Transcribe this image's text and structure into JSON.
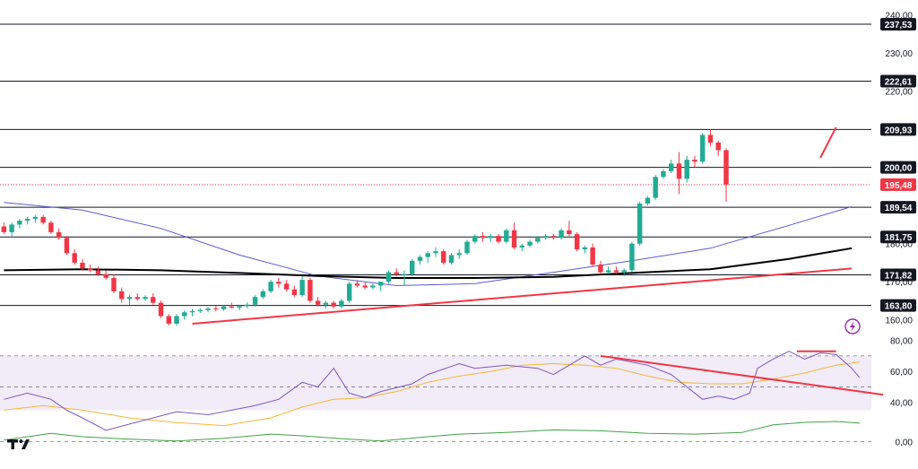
{
  "colors": {
    "up": "#22ab94",
    "down": "#f23645",
    "level_line": "#131722",
    "trend_line": "#f23645",
    "ma_fast": "#5b5bd6",
    "ma_slow": "#000000",
    "rsi_line": "#7e57c2",
    "rsi_ma": "#f7b733",
    "rsi_band": "#ede7f6",
    "macd_line": "#43a047",
    "current_price": "#f23645",
    "axis_text": "#131722"
  },
  "icons": {
    "logo": "tradingview-logo-icon",
    "alert": "lightning-icon"
  },
  "logo_text": "TV",
  "chart_data": [
    {
      "type": "candlestick",
      "title": "",
      "ylim": [
        155,
        242
      ],
      "price_axis_ticks": [
        "240,00",
        "230,00",
        "220,00",
        "180,00",
        "170,00",
        "160,00"
      ],
      "price_axis_tick_values": [
        240,
        230,
        220,
        180,
        170,
        160
      ],
      "levels": [
        {
          "value": 237.53,
          "label": "237,53"
        },
        {
          "value": 222.61,
          "label": "222,61"
        },
        {
          "value": 209.93,
          "label": "209,93"
        },
        {
          "value": 200.0,
          "label": "200,00"
        },
        {
          "value": 189.54,
          "label": "189,54"
        },
        {
          "value": 181.75,
          "label": "181,75"
        },
        {
          "value": 171.82,
          "label": "171,82"
        },
        {
          "value": 163.8,
          "label": "163,80"
        }
      ],
      "current_price": {
        "value": 195.48,
        "label": "195,48"
      },
      "candles": [
        [
          184.5,
          185.5,
          182.5,
          183.0
        ],
        [
          183.0,
          185.5,
          182.0,
          185.0
        ],
        [
          185.0,
          186.5,
          184.0,
          186.0
        ],
        [
          186.0,
          187.0,
          185.0,
          186.5
        ],
        [
          186.5,
          187.5,
          185.5,
          187.0
        ],
        [
          187.0,
          187.5,
          185.0,
          185.5
        ],
        [
          185.5,
          186.0,
          182.5,
          183.0
        ],
        [
          183.0,
          184.0,
          181.0,
          181.5
        ],
        [
          181.5,
          182.0,
          177.0,
          177.5
        ],
        [
          177.5,
          178.5,
          174.5,
          175.0
        ],
        [
          175.0,
          176.0,
          173.0,
          173.5
        ],
        [
          173.5,
          174.5,
          172.5,
          173.0
        ],
        [
          173.0,
          174.0,
          171.5,
          172.0
        ],
        [
          172.0,
          173.0,
          170.5,
          171.0
        ],
        [
          171.0,
          172.0,
          167.0,
          167.5
        ],
        [
          167.5,
          168.5,
          164.5,
          165.5
        ],
        [
          165.5,
          166.5,
          164.0,
          166.0
        ],
        [
          166.0,
          167.0,
          165.0,
          165.5
        ],
        [
          165.5,
          166.5,
          165.0,
          166.0
        ],
        [
          166.0,
          167.0,
          164.0,
          164.5
        ],
        [
          164.5,
          165.0,
          160.5,
          161.0
        ],
        [
          161.0,
          161.5,
          158.5,
          159.0
        ],
        [
          159.0,
          161.5,
          158.5,
          161.0
        ],
        [
          161.0,
          162.5,
          160.0,
          162.0
        ],
        [
          162.0,
          162.8,
          161.0,
          162.3
        ],
        [
          162.3,
          163.0,
          161.8,
          162.6
        ],
        [
          162.6,
          163.4,
          162.0,
          163.0
        ],
        [
          163.0,
          163.6,
          162.2,
          162.8
        ],
        [
          162.8,
          163.8,
          162.4,
          163.5
        ],
        [
          163.5,
          164.5,
          163.0,
          163.2
        ],
        [
          163.2,
          164.0,
          162.5,
          163.6
        ],
        [
          163.6,
          164.6,
          163.0,
          164.0
        ],
        [
          164.0,
          166.5,
          163.5,
          166.0
        ],
        [
          166.0,
          168.0,
          165.5,
          167.5
        ],
        [
          167.5,
          170.5,
          167.0,
          170.0
        ],
        [
          170.0,
          171.0,
          168.5,
          169.5
        ],
        [
          169.5,
          170.5,
          167.5,
          168.0
        ],
        [
          168.0,
          169.0,
          166.0,
          166.5
        ],
        [
          166.5,
          171.5,
          166.0,
          170.5
        ],
        [
          170.5,
          171.0,
          164.5,
          165.0
        ],
        [
          165.0,
          166.0,
          163.5,
          164.0
        ],
        [
          164.0,
          165.0,
          163.0,
          164.5
        ],
        [
          164.5,
          165.0,
          163.0,
          163.5
        ],
        [
          163.5,
          165.5,
          163.0,
          165.0
        ],
        [
          165.0,
          170.0,
          164.5,
          169.5
        ],
        [
          169.5,
          170.5,
          168.5,
          169.0
        ],
        [
          169.0,
          170.0,
          168.0,
          168.5
        ],
        [
          168.5,
          169.5,
          168.0,
          169.0
        ],
        [
          169.0,
          170.0,
          167.5,
          170.0
        ],
        [
          170.0,
          173.0,
          169.5,
          172.5
        ],
        [
          172.5,
          173.5,
          171.5,
          172.0
        ],
        [
          172.0,
          173.0,
          169.0,
          172.0
        ],
        [
          172.0,
          176.0,
          171.5,
          175.5
        ],
        [
          175.5,
          177.0,
          174.5,
          176.5
        ],
        [
          176.5,
          178.0,
          175.0,
          177.5
        ],
        [
          177.5,
          179.0,
          176.5,
          178.0
        ],
        [
          178.0,
          178.5,
          174.5,
          175.0
        ],
        [
          175.0,
          177.5,
          174.5,
          177.0
        ],
        [
          177.0,
          178.5,
          176.0,
          177.5
        ],
        [
          177.5,
          181.0,
          177.0,
          180.5
        ],
        [
          180.5,
          182.5,
          180.0,
          182.0
        ],
        [
          182.0,
          183.0,
          180.5,
          181.5
        ],
        [
          181.5,
          182.5,
          180.5,
          182.0
        ],
        [
          182.0,
          182.5,
          180.0,
          180.5
        ],
        [
          180.5,
          184.0,
          180.0,
          183.5
        ],
        [
          183.5,
          185.5,
          178.5,
          179.0
        ],
        [
          179.0,
          180.0,
          178.0,
          179.5
        ],
        [
          179.5,
          181.0,
          179.0,
          180.5
        ],
        [
          180.5,
          182.0,
          180.0,
          181.5
        ],
        [
          181.5,
          182.5,
          181.0,
          182.0
        ],
        [
          182.0,
          182.5,
          181.0,
          181.5
        ],
        [
          181.5,
          184.0,
          181.0,
          183.5
        ],
        [
          183.5,
          186.0,
          182.0,
          182.5
        ],
        [
          182.5,
          183.0,
          178.0,
          178.5
        ],
        [
          178.5,
          179.5,
          177.5,
          179.0
        ],
        [
          179.0,
          180.0,
          174.0,
          174.5
        ],
        [
          174.5,
          175.5,
          172.0,
          172.5
        ],
        [
          172.5,
          174.0,
          172.0,
          173.0
        ],
        [
          173.0,
          174.0,
          172.0,
          172.5
        ],
        [
          172.5,
          173.5,
          171.5,
          173.0
        ],
        [
          173.0,
          180.5,
          172.5,
          180.0
        ],
        [
          180.0,
          191.0,
          179.5,
          190.5
        ],
        [
          190.5,
          192.5,
          190.0,
          192.0
        ],
        [
          192.0,
          198.0,
          191.5,
          197.5
        ],
        [
          197.5,
          199.5,
          197.0,
          199.0
        ],
        [
          199.0,
          202.0,
          198.5,
          201.0
        ],
        [
          201.0,
          204.0,
          193.0,
          197.0
        ],
        [
          197.0,
          203.0,
          196.0,
          202.0
        ],
        [
          202.0,
          203.0,
          200.0,
          201.5
        ],
        [
          201.5,
          209.0,
          201.0,
          208.5
        ],
        [
          208.5,
          210.0,
          205.5,
          206.5
        ],
        [
          206.5,
          207.0,
          203.0,
          204.5
        ],
        [
          204.5,
          205.0,
          191.0,
          195.48
        ]
      ],
      "ma_fast": [
        [
          0,
          190.8
        ],
        [
          10,
          188.8
        ],
        [
          20,
          184.0
        ],
        [
          30,
          177.0
        ],
        [
          40,
          171.5
        ],
        [
          50,
          169.0
        ],
        [
          60,
          169.5
        ],
        [
          70,
          172.5
        ],
        [
          80,
          175.5
        ],
        [
          90,
          178.8
        ],
        [
          100,
          184.8
        ],
        [
          108,
          189.7
        ]
      ],
      "ma_slow": [
        [
          0,
          173.0
        ],
        [
          10,
          173.3
        ],
        [
          20,
          173.0
        ],
        [
          30,
          172.3
        ],
        [
          40,
          171.5
        ],
        [
          50,
          171.0
        ],
        [
          60,
          171.0
        ],
        [
          70,
          171.3
        ],
        [
          80,
          172.3
        ],
        [
          90,
          173.3
        ],
        [
          100,
          176.0
        ],
        [
          108,
          178.8
        ]
      ],
      "trendlines": [
        {
          "from": [
            24,
            159.0
          ],
          "to": [
            108,
            173.5
          ]
        },
        {
          "from": [
            104,
            202.5
          ],
          "to": [
            106,
            210.5
          ]
        }
      ],
      "x_range": [
        0,
        111
      ]
    },
    {
      "type": "line",
      "title": "",
      "ylim": [
        30,
        85
      ],
      "ticks": [
        {
          "value": 80,
          "label": "80,00"
        },
        {
          "value": 60,
          "label": "60,00"
        },
        {
          "value": 40,
          "label": "40,00"
        }
      ],
      "bands": [
        70,
        50
      ],
      "series": [
        {
          "values": [
            [
              0,
              42
            ],
            [
              3,
              46
            ],
            [
              6,
              42
            ],
            [
              8,
              35
            ],
            [
              10,
              30
            ],
            [
              13,
              22
            ],
            [
              16,
              26
            ],
            [
              22,
              34
            ],
            [
              26,
              32
            ],
            [
              32,
              38
            ],
            [
              35,
              42
            ],
            [
              38,
              53
            ],
            [
              40,
              50
            ],
            [
              42,
              62
            ],
            [
              44,
              46
            ],
            [
              46,
              43
            ],
            [
              48,
              47
            ],
            [
              52,
              52
            ],
            [
              54,
              58
            ],
            [
              58,
              65
            ],
            [
              60,
              62
            ],
            [
              64,
              64
            ],
            [
              68,
              62
            ],
            [
              70,
              58
            ],
            [
              74,
              70
            ],
            [
              76,
              64
            ],
            [
              78,
              68
            ],
            [
              80,
              66
            ],
            [
              82,
              64
            ],
            [
              85,
              58
            ],
            [
              87,
              50
            ],
            [
              89,
              42
            ],
            [
              91,
              44
            ],
            [
              93,
              42
            ],
            [
              95,
              46
            ],
            [
              96,
              62
            ],
            [
              98,
              68
            ],
            [
              100,
              73
            ],
            [
              102,
              68
            ],
            [
              104,
              72
            ],
            [
              106,
              71
            ],
            [
              108,
              62
            ],
            [
              109,
              56
            ]
          ]
        },
        {
          "values": [
            [
              0,
              35
            ],
            [
              5,
              38
            ],
            [
              10,
              35
            ],
            [
              16,
              30
            ],
            [
              22,
              27
            ],
            [
              28,
              25
            ],
            [
              34,
              30
            ],
            [
              38,
              37
            ],
            [
              42,
              42
            ],
            [
              46,
              43
            ],
            [
              50,
              47
            ],
            [
              54,
              53
            ],
            [
              58,
              57
            ],
            [
              62,
              60
            ],
            [
              66,
              64
            ],
            [
              70,
              65
            ],
            [
              74,
              64
            ],
            [
              78,
              62
            ],
            [
              82,
              57
            ],
            [
              86,
              53
            ],
            [
              90,
              52
            ],
            [
              94,
              52
            ],
            [
              98,
              55
            ],
            [
              102,
              59
            ],
            [
              106,
              64
            ],
            [
              109,
              66
            ]
          ]
        }
      ],
      "trendlines": [
        {
          "from": [
            76,
            70
          ],
          "to": [
            112,
            45
          ]
        },
        {
          "from": [
            101,
            73
          ],
          "to": [
            106,
            73
          ]
        }
      ],
      "x_range": [
        0,
        111
      ]
    },
    {
      "type": "line",
      "title": "",
      "ylim": [
        -1,
        4
      ],
      "ticks": [
        {
          "value": 0,
          "label": "0,00"
        }
      ],
      "series": [
        {
          "values": [
            [
              0,
              0.2
            ],
            [
              6,
              1.0
            ],
            [
              10,
              0.6
            ],
            [
              16,
              0.3
            ],
            [
              22,
              0.1
            ],
            [
              28,
              0.4
            ],
            [
              34,
              0.9
            ],
            [
              38,
              0.7
            ],
            [
              44,
              0.3
            ],
            [
              48,
              0.1
            ],
            [
              54,
              0.6
            ],
            [
              58,
              0.9
            ],
            [
              64,
              1.1
            ],
            [
              70,
              1.4
            ],
            [
              76,
              1.3
            ],
            [
              82,
              1.0
            ],
            [
              88,
              0.9
            ],
            [
              94,
              1.1
            ],
            [
              98,
              2.0
            ],
            [
              102,
              2.3
            ],
            [
              106,
              2.4
            ],
            [
              109,
              2.2
            ]
          ]
        }
      ],
      "x_range": [
        0,
        111
      ]
    }
  ]
}
